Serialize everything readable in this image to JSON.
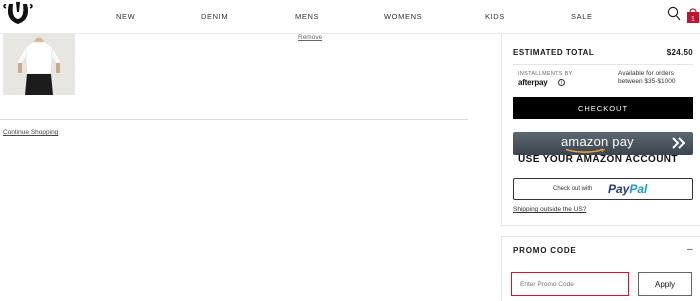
{
  "header": {
    "nav": [
      "NEW",
      "DENIM",
      "MENS",
      "WOMENS",
      "KIDS",
      "SALE"
    ],
    "bag_count": "1",
    "logo_icon": "horseshoe-logo-icon",
    "search_icon": "search-icon",
    "bag_icon": "shopping-bag-icon"
  },
  "cart": {
    "remove_label": "Remove",
    "continue_label": "Continue Shopping"
  },
  "summary": {
    "estimated_total_label": "ESTIMATED TOTAL",
    "estimated_total_value": "$24.50",
    "installments_label": "INSTALLMENTS BY",
    "afterpay_label": "afterpay",
    "installments_info": "Available for orders between $35-$1000",
    "checkout_label": "CHECKOUT",
    "amazon_pay_label": "amazon pay",
    "amazon_caption": "USE YOUR AMAZON ACCOUNT",
    "paypal_prefix": "Check out with",
    "paypal_label_pay": "Pay",
    "paypal_label_pal": "Pal",
    "shipping_link": "Shipping outside the US?"
  },
  "promo": {
    "label": "PROMO CODE",
    "toggle": "–",
    "placeholder": "Enter Promo Code",
    "apply_label": "Apply"
  },
  "colors": {
    "checkout_bg": "#000000",
    "bag_badge": "#c8102e",
    "promo_border": "#d9112a",
    "paypal_blue": "#253b80",
    "paypal_light": "#179bd7",
    "amazon_orange": "#f9a53b"
  }
}
